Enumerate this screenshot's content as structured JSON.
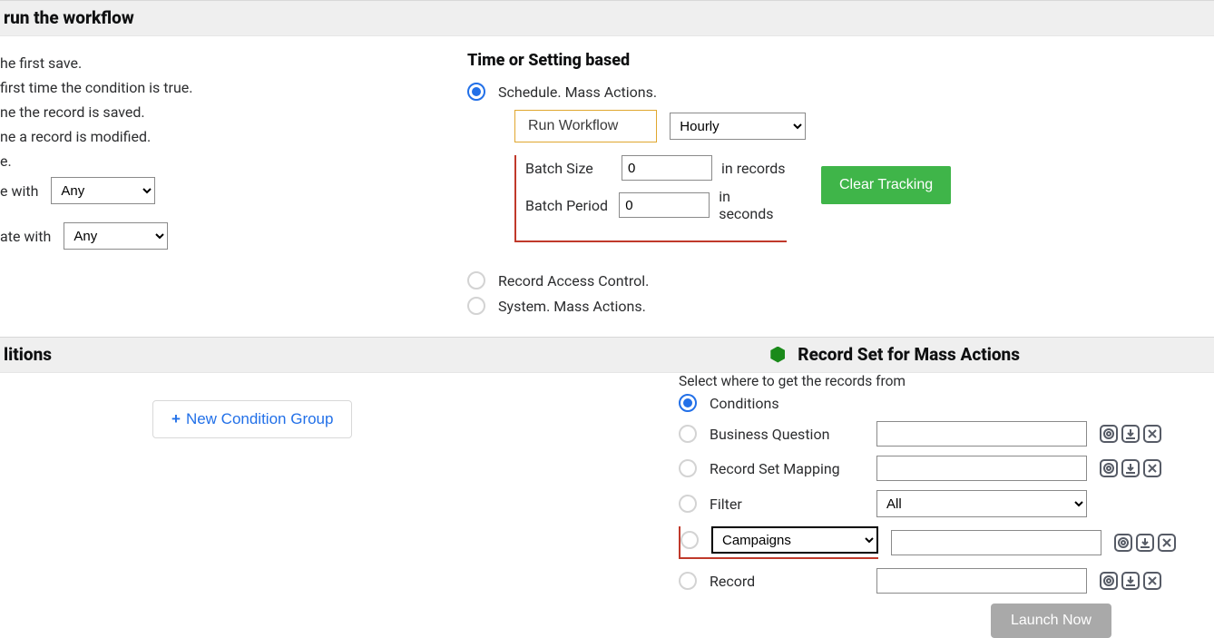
{
  "section1": {
    "title": "run the workflow",
    "left_options": [
      "he first save.",
      "first time the condition is true.",
      "ne the record is saved.",
      "ne a record is modified.",
      "e."
    ],
    "select_row1_prefix": "e with",
    "select_row2_prefix": "ate with",
    "any_options": [
      "Any"
    ],
    "right": {
      "heading": "Time or Setting based",
      "schedule_label": "Schedule. Mass Actions.",
      "run_workflow_btn": "Run Workflow",
      "freq_options": [
        "Hourly"
      ],
      "batch_size_label": "Batch Size",
      "batch_size_value": "0",
      "batch_size_unit": "in records",
      "batch_period_label": "Batch Period",
      "batch_period_value": "0",
      "batch_period_unit": "in seconds",
      "clear_tracking_btn": "Clear Tracking",
      "rac_label": "Record Access Control.",
      "sma_label": "System. Mass Actions."
    }
  },
  "section2": {
    "left_title": "litions",
    "right_title": "Record Set for Mass Actions",
    "new_cond_btn": "New Condition Group",
    "recset": {
      "heading": "Select where to get the records from",
      "conditions_label": "Conditions",
      "bq_label": "Business Question",
      "rsm_label": "Record Set Mapping",
      "filter_label": "Filter",
      "filter_options": [
        "All"
      ],
      "campaign_options": [
        "Campaigns"
      ],
      "record_label": "Record"
    },
    "launch_btn": "Launch Now"
  },
  "icons": {
    "target": "target-icon",
    "import": "import-icon",
    "remove": "remove-icon"
  }
}
